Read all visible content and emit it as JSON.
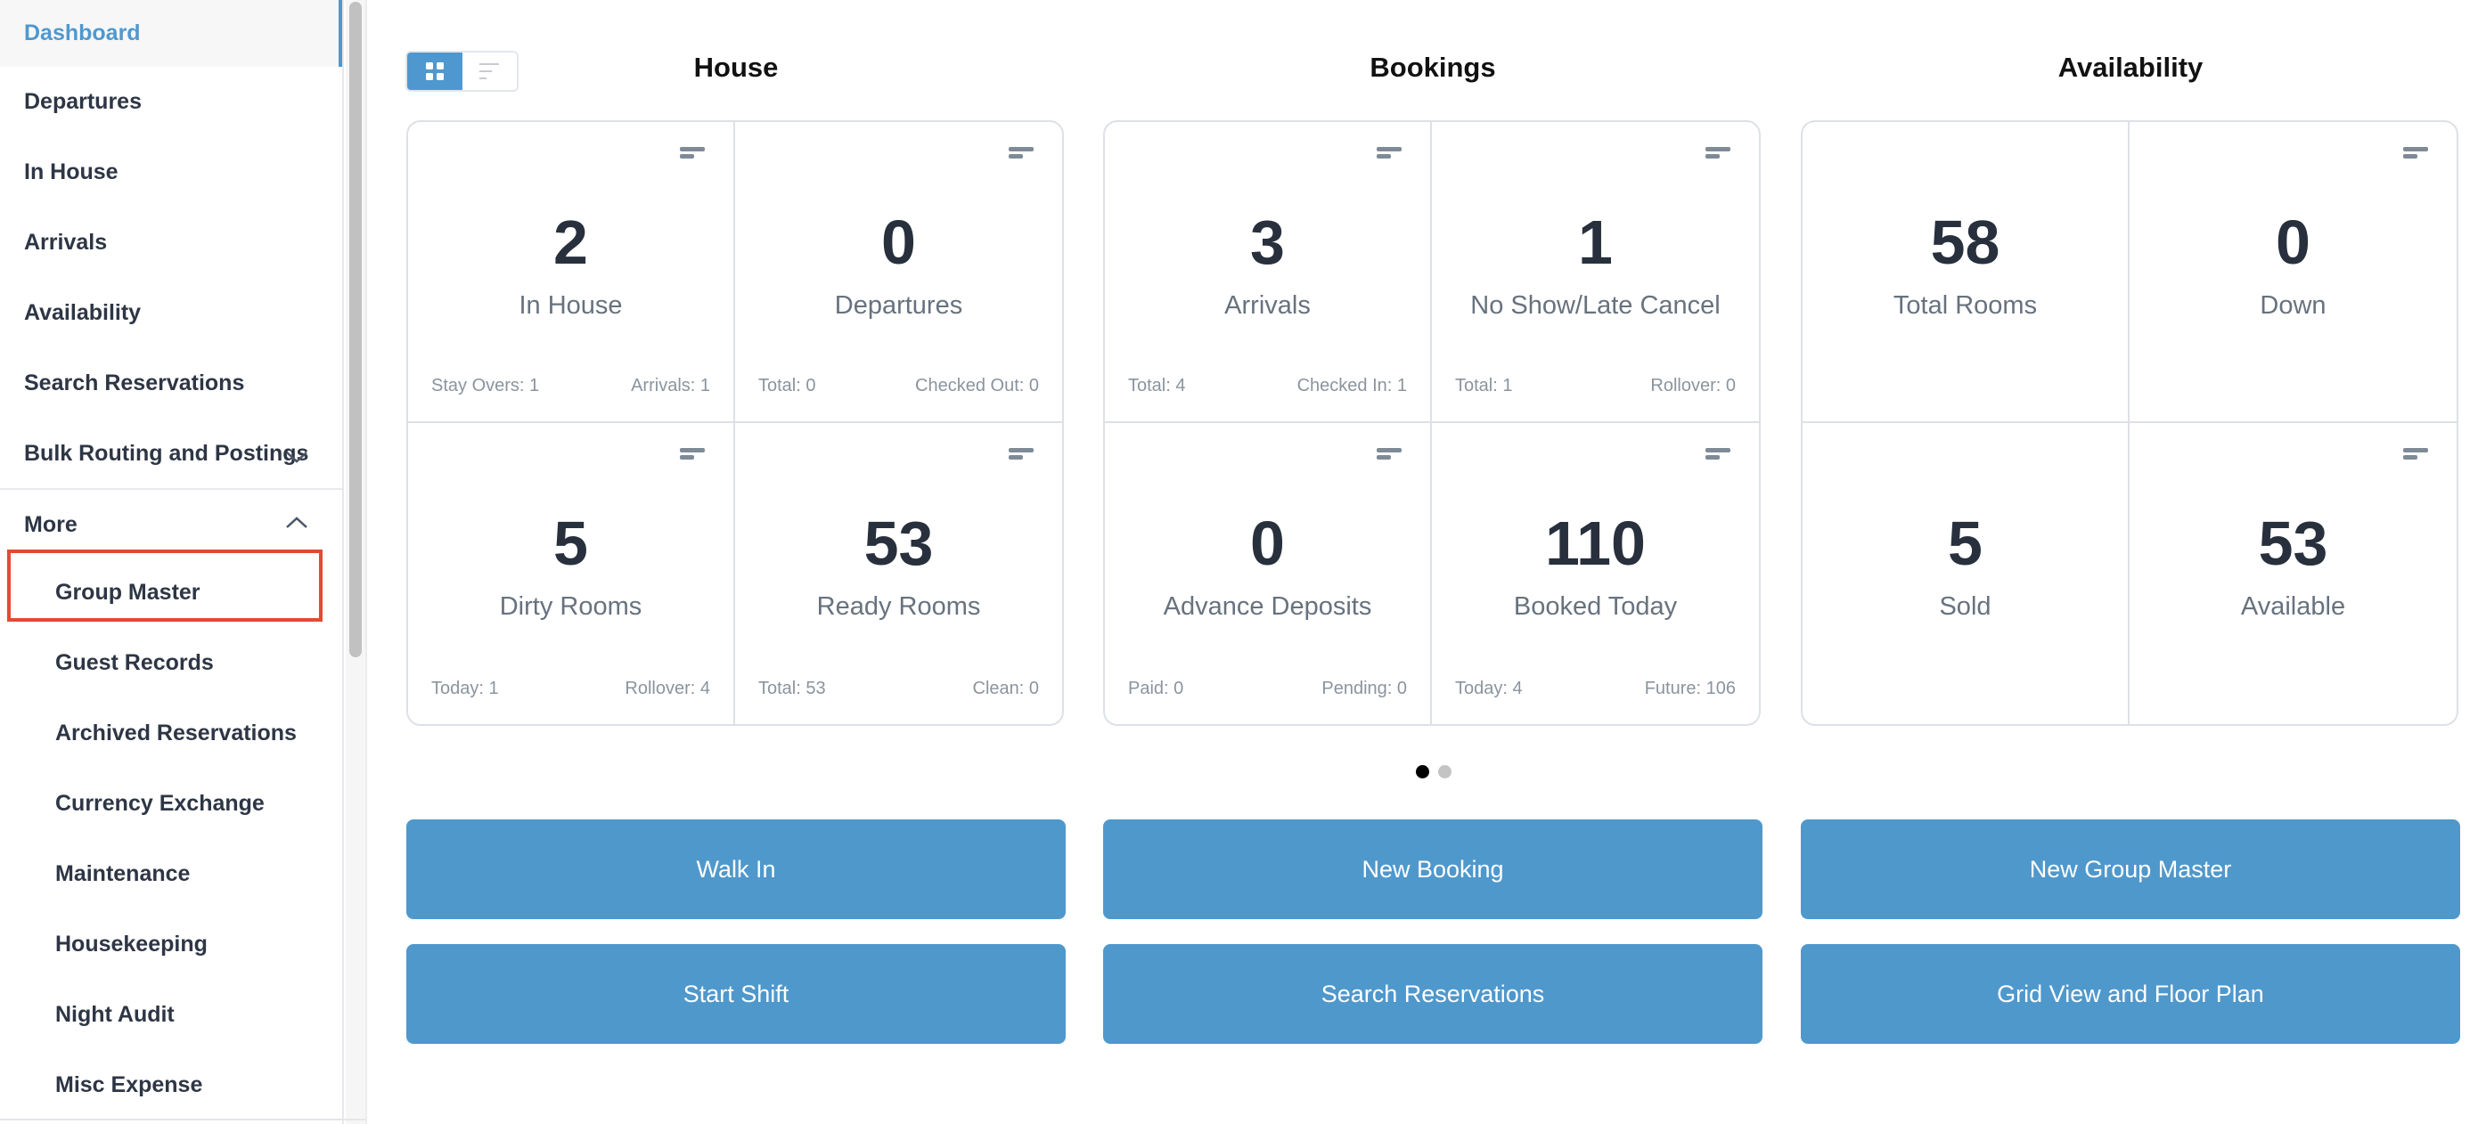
{
  "sidebar": {
    "items": [
      {
        "label": "Dashboard",
        "active": true
      },
      {
        "label": "Departures"
      },
      {
        "label": "In House"
      },
      {
        "label": "Arrivals"
      },
      {
        "label": "Availability"
      },
      {
        "label": "Search Reservations"
      },
      {
        "label": "Bulk Routing and Postings",
        "icon": "chevron-down-icon"
      },
      {
        "label": "More",
        "icon": "chevron-up-icon",
        "expanded": true
      }
    ],
    "sub_items": [
      {
        "label": "Group Master",
        "highlighted": true
      },
      {
        "label": "Guest Records"
      },
      {
        "label": "Archived Reservations"
      },
      {
        "label": "Currency Exchange"
      },
      {
        "label": "Maintenance"
      },
      {
        "label": "Housekeeping"
      },
      {
        "label": "Night Audit"
      },
      {
        "label": "Misc Expense"
      }
    ]
  },
  "view_toggle": {
    "options": [
      "grid-icon",
      "list-icon"
    ],
    "selected": "grid-icon"
  },
  "sections": [
    {
      "title": "House",
      "tiles": [
        {
          "value": "2",
          "label": "In House",
          "foot_left": "Stay Overs: 1",
          "foot_right": "Arrivals: 1",
          "menu": true
        },
        {
          "value": "0",
          "label": "Departures",
          "foot_left": "Total: 0",
          "foot_right": "Checked Out: 0",
          "menu": true
        },
        {
          "value": "5",
          "label": "Dirty Rooms",
          "foot_left": "Today: 1",
          "foot_right": "Rollover: 4",
          "menu": true
        },
        {
          "value": "53",
          "label": "Ready Rooms",
          "foot_left": "Total: 53",
          "foot_right": "Clean: 0",
          "menu": true
        }
      ]
    },
    {
      "title": "Bookings",
      "tiles": [
        {
          "value": "3",
          "label": "Arrivals",
          "foot_left": "Total: 4",
          "foot_right": "Checked In: 1",
          "menu": true
        },
        {
          "value": "1",
          "label": "No Show/Late Cancel",
          "foot_left": "Total: 1",
          "foot_right": "Rollover: 0",
          "menu": true
        },
        {
          "value": "0",
          "label": "Advance Deposits",
          "foot_left": "Paid: 0",
          "foot_right": "Pending: 0",
          "menu": true
        },
        {
          "value": "110",
          "label": "Booked Today",
          "foot_left": "Today: 4",
          "foot_right": "Future: 106",
          "menu": true
        }
      ]
    },
    {
      "title": "Availability",
      "tiles": [
        {
          "value": "58",
          "label": "Total Rooms",
          "foot_left": "",
          "foot_right": "",
          "menu": false
        },
        {
          "value": "0",
          "label": "Down",
          "foot_left": "",
          "foot_right": "",
          "menu": true
        },
        {
          "value": "5",
          "label": "Sold",
          "foot_left": "",
          "foot_right": "",
          "menu": false
        },
        {
          "value": "53",
          "label": "Available",
          "foot_left": "",
          "foot_right": "",
          "menu": true
        }
      ]
    }
  ],
  "pagination": {
    "pages": 2,
    "current": 1
  },
  "actions": [
    [
      "Walk In",
      "New Booking",
      "New Group Master"
    ],
    [
      "Start Shift",
      "Search Reservations",
      "Grid View and Floor Plan"
    ]
  ],
  "colors": {
    "accent": "#4f98cf",
    "button": "#4f98cc",
    "highlight": "#e24a33"
  }
}
